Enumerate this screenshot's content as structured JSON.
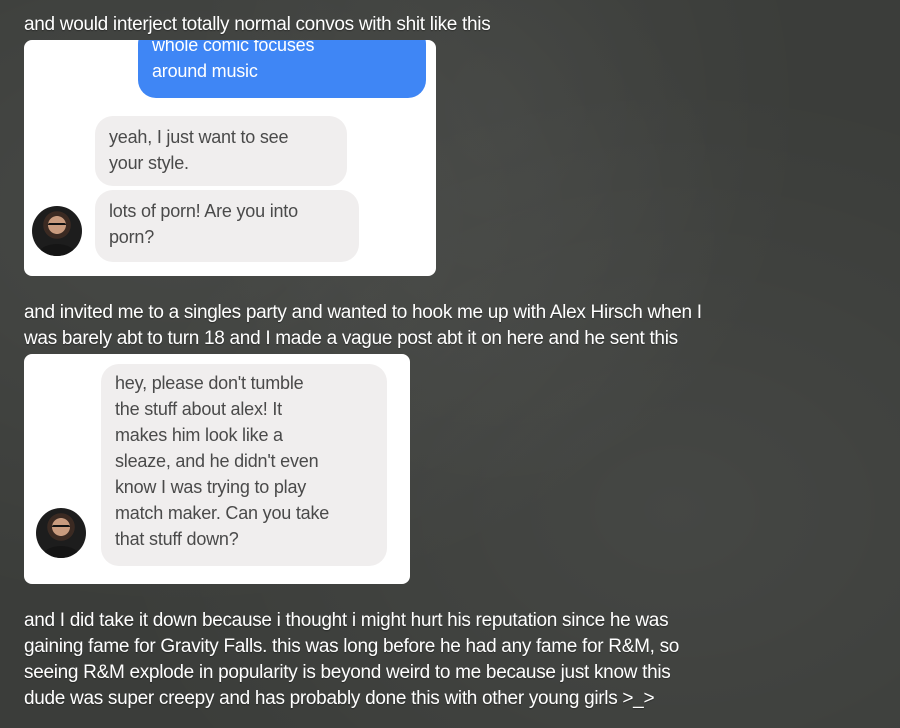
{
  "intro_text": "and would interject totally normal convos with shit like this",
  "chat1": {
    "sent_lines": [
      "whole comic focuses",
      "around music"
    ],
    "recv1_lines": [
      "yeah, I just want to see",
      "your style."
    ],
    "recv2_lines": [
      "lots of porn! Are you into",
      "porn?"
    ]
  },
  "middle_text": [
    "and invited me to a singles party and wanted to hook me up with Alex Hirsch when I",
    "was barely abt to turn 18 and I made a vague post abt it on here and he sent this"
  ],
  "chat2": {
    "recv_lines": [
      "hey, please don't tumble",
      "the stuff about alex! It",
      "makes him look like a",
      "sleaze, and he didn't even",
      "know I was trying to play",
      "match maker. Can you take",
      "that stuff down?"
    ]
  },
  "outro_text": [
    "and I did take it down because i thought i might hurt his reputation since he was",
    "gaining fame for Gravity Falls. this was long before he had any fame for R&M, so",
    "seeing R&M explode in popularity is beyond weird to me because  just know this",
    "dude was super creepy and has probably done this with other young girls >_>"
  ],
  "colors": {
    "sent_bubble": "#3f86f5",
    "recv_bubble": "#f0eeee",
    "background": "#3b3d3a"
  },
  "icons": [
    "avatar-icon"
  ]
}
